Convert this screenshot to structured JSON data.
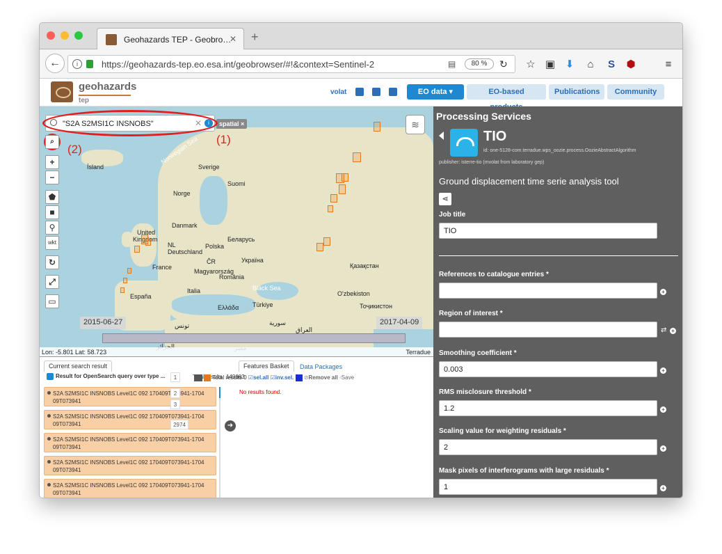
{
  "browser": {
    "tab_title": "Geohazards TEP - Geobro…",
    "url": "https://geohazards-tep.eo.esa.int/geobrowser/#!&context=Sentinel-2",
    "zoom": "80 %"
  },
  "header": {
    "brand": "geohazards",
    "brand_sub": "tep",
    "user": "volat",
    "nav": [
      "EO data ▾",
      "EO-based products",
      "Publications",
      "Community"
    ]
  },
  "map": {
    "search_value": "\"S2A S2MSI1C INSNOBS\"",
    "spatial_tag": "spatial ×",
    "annotation_1": "(1)",
    "annotation_2": "(2)",
    "wkt": "wkt",
    "date_start": "2015-06-27",
    "date_end": "2017-04-09",
    "coords": "Lon: -5.801  Lat: 58.723",
    "attribution": "Terradue",
    "labels": {
      "island": "Ísland",
      "sverige": "Sverige",
      "suomi": "Suomi",
      "norge": "Norge",
      "norwegian_sea": "Norwegian Sea",
      "uk1": "United",
      "uk2": "Kingdom",
      "danmark": "Danmark",
      "deutschland": "Deutschland",
      "nl": "NL",
      "polska": "Polska",
      "belarus": "Беларусь",
      "france": "France",
      "cz": "ČR",
      "ukraina": "Україна",
      "magyar": "Magyarország",
      "romania": "România",
      "kazakhstan": "Қазақстан",
      "italia": "Italia",
      "black_sea": "Black Sea",
      "espana": "España",
      "ellada": "Ελλάδα",
      "turkiye": "Türkiye",
      "uzbekiston": "O'zbekiston",
      "tojikiston": "Тоҷикистон",
      "tunis": "تونس",
      "suriya": "سورية",
      "iraq": "العراق",
      "jazair": "الجزائر",
      "misr": "مصر"
    }
  },
  "results": {
    "tab_current": "Current search result",
    "query_label": "Result for OpenSearch query over type ...",
    "total_label": "Total results",
    "total_value": "149683",
    "tab_basket": "Features Basket",
    "tab_packages": "Data Packages",
    "basket_total": "Total results",
    "basket_total_value": "0",
    "sel_all": "sel.all",
    "inv_sel": "inv.sel.",
    "remove_all": "Remove all",
    "save": "Save",
    "no_results": "No results found.",
    "pages": [
      "1",
      "2",
      "3",
      "2974"
    ],
    "items": [
      {
        "line1": "S2A S2MSI1C INSNOBS Level1C 092 170409T073941-1704",
        "line2": "09T073941"
      },
      {
        "line1": "S2A S2MSI1C INSNOBS Level1C 092 170409T073941-1704",
        "line2": "09T073941"
      },
      {
        "line1": "S2A S2MSI1C INSNOBS Level1C 092 170409T073941-1704",
        "line2": "09T073941"
      },
      {
        "line1": "S2A S2MSI1C INSNOBS Level1C 092 170409T073941-1704",
        "line2": "09T073941"
      },
      {
        "line1": "S2A S2MSI1C INSNOBS Level1C 092 170409T073941-1704",
        "line2": "09T073941"
      }
    ]
  },
  "processing": {
    "title": "Processing Services",
    "app_name": "TIO",
    "app_id": "id: one-5128-com.terradue.wps_oozie.process.OozieAbstractAlgorithm",
    "publisher": "publisher: isterre-tio (mvolat from laboratory gep)",
    "description": "Ground displacement time serie analysis tool",
    "job_title_label": "Job title",
    "job_title_value": "TIO",
    "fields": [
      {
        "label": "References to catalogue entries *",
        "value": ""
      },
      {
        "label": "Region of interest *",
        "value": ""
      },
      {
        "label": "Smoothing coefficient *",
        "value": "0.003"
      },
      {
        "label": "RMS misclosure threshold *",
        "value": "1.2"
      },
      {
        "label": "Scaling value for weighting residuals *",
        "value": "2"
      },
      {
        "label": "Mask pixels of interferograms with large residuals *",
        "value": "1"
      }
    ]
  }
}
